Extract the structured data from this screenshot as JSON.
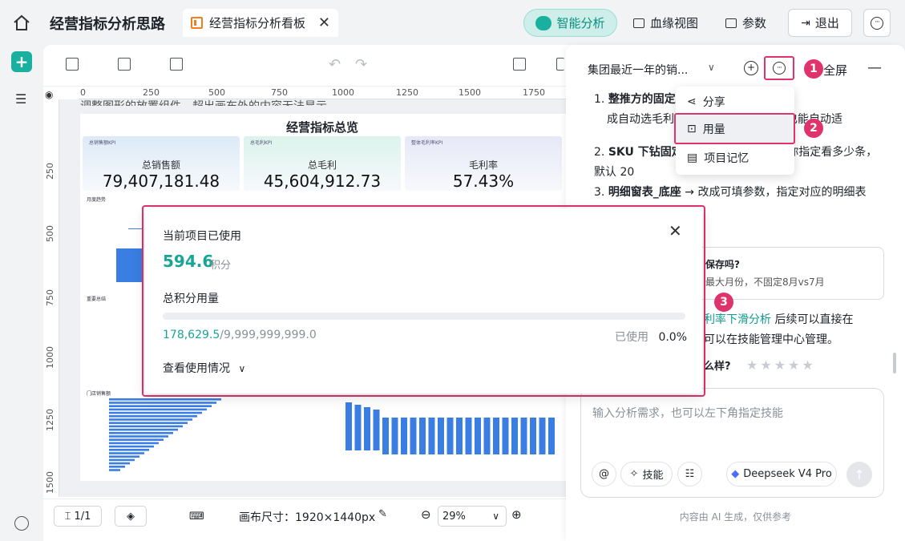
{
  "header": {
    "app_title": "经营指标分析思路",
    "tab_label": "经营指标分析看板",
    "ai_button": "智能分析",
    "lineage_button": "血缘视图",
    "params_button": "参数",
    "exit_button": "退出"
  },
  "canvas": {
    "ruler_h": [
      "0",
      "250",
      "500",
      "750",
      "1000",
      "1250",
      "1500",
      "1750"
    ],
    "ruler_v": [
      "250",
      "500",
      "750",
      "1000",
      "1250",
      "1500"
    ],
    "cut_text": "调整图形的放置组件，超出画布外的内容无法显示",
    "dashboard_title": "经营指标总览",
    "kpis": [
      {
        "tag": "总销售额KPI",
        "name": "总销售额",
        "value": "79,407,181.48",
        "bg": "#dceaf7"
      },
      {
        "tag": "总毛利KPI",
        "name": "总毛利",
        "value": "45,604,912.73",
        "bg": "#dcf3ec"
      },
      {
        "tag": "整体毛利率KPI",
        "name": "毛利率",
        "value": "57.43%",
        "bg": "#e6e8f7"
      }
    ],
    "section_trend": "月度趋势",
    "section_summary": "重要总结",
    "section_store": "门店销售额",
    "page_indicator": "1/1",
    "canvas_size": "画布尺寸：1920×1440px",
    "zoom": "29%"
  },
  "panel": {
    "session_title": "集团最近一年的销...",
    "fullscreen": "全屏",
    "dropdown": [
      "分享",
      "用量",
      "项目记忆"
    ],
    "badges": [
      "1",
      "2",
      "3"
    ],
    "chat_lines": [
      {
        "num": "1.",
        "bold": "整推方的固定…月对比，改为7月",
        "text": "成自动选毛利…比的最大月，换数据也能自动适"
      },
      {
        "num": "2.",
        "bold": "SKU 下钻固定",
        "text": "或可填参数，每次由你指定看多少条，默认 20"
      },
      {
        "num": "3.",
        "bold": "明细窗表_底座",
        "text": "→ 改成可填参数，指定对应的明细表"
      }
    ],
    "card_q": "保存吗?",
    "card_a": "最大月份，不固定8月vs7月",
    "skill_link": "利率下滑分析",
    "skill_text": "后续可以直接在",
    "skill_text2": "可以在技能管理中心管理。",
    "rate_q": "么样?",
    "input_placeholder": "输入分析需求，也可以左下角指定技能",
    "skill_button": "技能",
    "model_button": "Deepseek V4 Pro",
    "footer": "内容由 AI 生成，仅供参考"
  },
  "modal": {
    "title": "当前项目已使用",
    "value": "594.6",
    "unit": "积分",
    "total_label": "总积分用量",
    "used": "178,629.5",
    "total": "/9,999,999,999.0",
    "used_label": "已使用",
    "percent": "0.0%",
    "detail": "查看使用情况"
  }
}
